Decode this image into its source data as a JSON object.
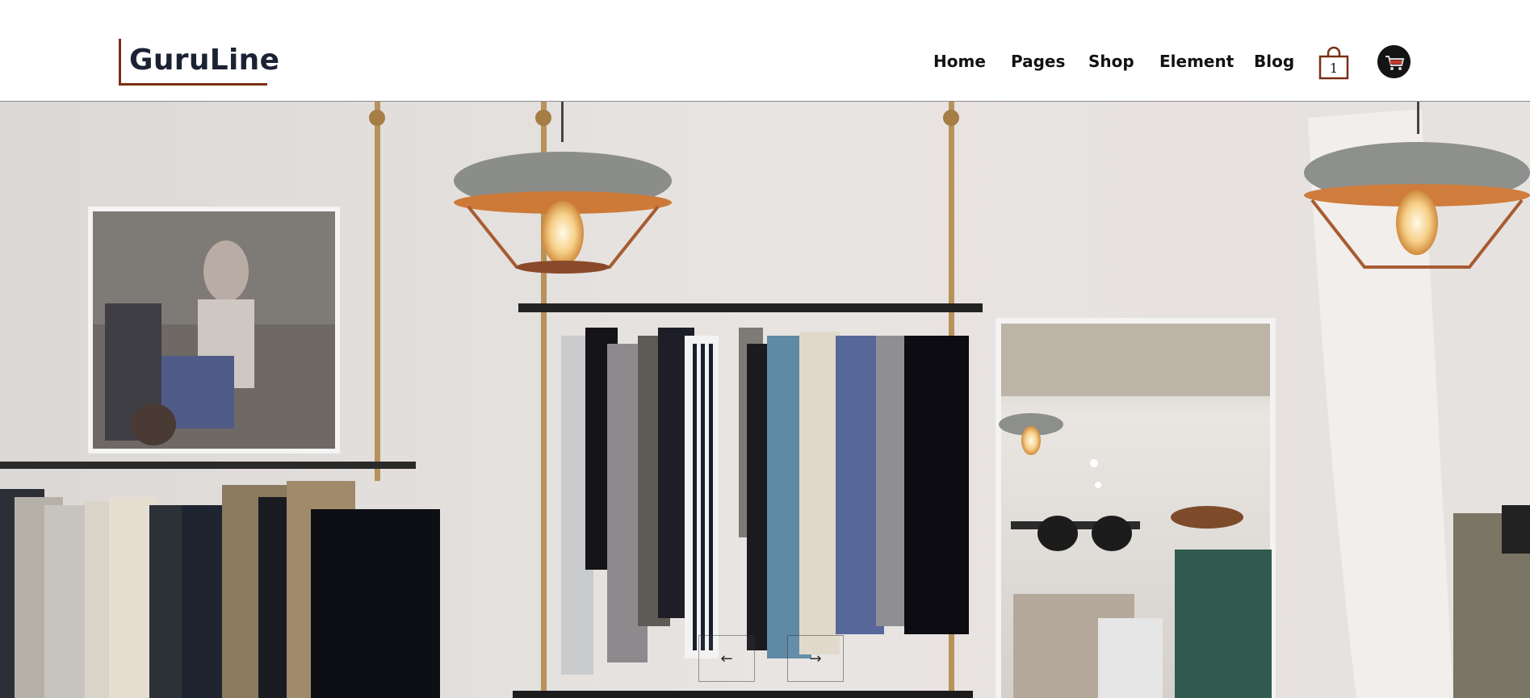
{
  "page": {
    "stray_char": "^"
  },
  "brand": {
    "logo_text": "GuruLine",
    "accent_color": "#7a2e14",
    "text_color": "#1b2233"
  },
  "nav": {
    "items": [
      {
        "label": "Home"
      },
      {
        "label": "Pages"
      },
      {
        "label": "Shop"
      },
      {
        "label": "Element"
      },
      {
        "label": "Blog"
      }
    ]
  },
  "cart": {
    "icon": "shopping-bag-icon",
    "count": "1"
  },
  "avatar": {
    "icon": "user-avatar-cart-icon"
  },
  "hero": {
    "image_subject": "clothing-store-interior",
    "slider": {
      "prev_icon": "arrow-left-icon",
      "prev_glyph": "←",
      "next_icon": "arrow-right-icon",
      "next_glyph": "→"
    }
  }
}
